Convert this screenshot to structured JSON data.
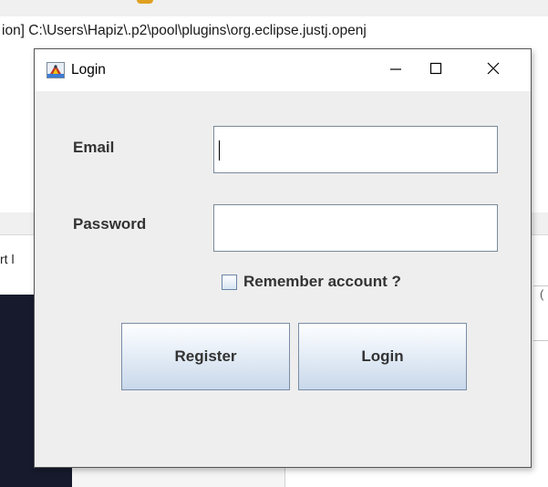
{
  "background": {
    "path_text": "ion] C:\\Users\\Hapiz\\.p2\\pool\\plugins\\org.eclipse.justj.openj",
    "cut_text": "rt l",
    "right_char": "("
  },
  "window": {
    "title": "Login",
    "icons": {
      "app": "java-app-icon",
      "minimize": "minimize-icon",
      "maximize": "maximize-icon",
      "close": "close-icon"
    }
  },
  "form": {
    "email_label": "Email",
    "email_value": "",
    "password_label": "Password",
    "password_value": "",
    "remember_label": "Remember account ?",
    "remember_checked": false
  },
  "buttons": {
    "register": "Register",
    "login": "Login"
  },
  "colors": {
    "dialog_bg": "#eeeeee",
    "label_text": "#333333",
    "field_border": "#7a8a99",
    "button_gradient_top": "#fdfeff",
    "button_gradient_bottom": "#c8d8ea"
  }
}
